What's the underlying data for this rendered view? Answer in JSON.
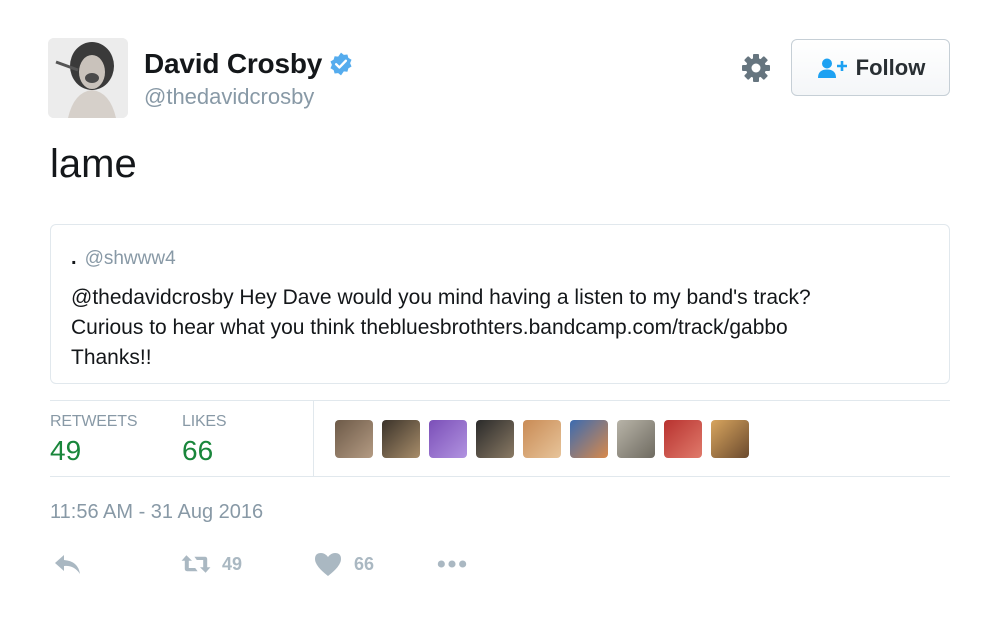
{
  "user": {
    "display_name": "David Crosby",
    "handle": "@thedavidcrosby"
  },
  "header": {
    "follow_label": "Follow"
  },
  "tweet": {
    "text": "lame"
  },
  "quoted_tweet": {
    "name": ".",
    "handle": "@shwww4",
    "text_line1": "@thedavidcrosby Hey Dave would you mind having a listen to my band's track?",
    "text_line2": "Curious to hear what you think thebluesbrothters.bandcamp.com/track/gabbo",
    "text_line3": "Thanks!!"
  },
  "stats": {
    "retweets_label": "RETWEETS",
    "retweets_count": "49",
    "likes_label": "LIKES",
    "likes_count": "66"
  },
  "timestamp": "11:56 AM - 31 Aug 2016",
  "actions": {
    "retweet_count": "49",
    "like_count": "66"
  },
  "colors": {
    "verified": "#55acee",
    "follow_icon": "#1da1f2",
    "stat_value": "#19863b",
    "muted": "#8899a6",
    "action_icon": "#aab8c2"
  },
  "icons": [
    "verified-badge-icon",
    "gear-icon",
    "follow-person-icon",
    "reply-icon",
    "retweet-icon",
    "heart-icon",
    "more-icon"
  ]
}
